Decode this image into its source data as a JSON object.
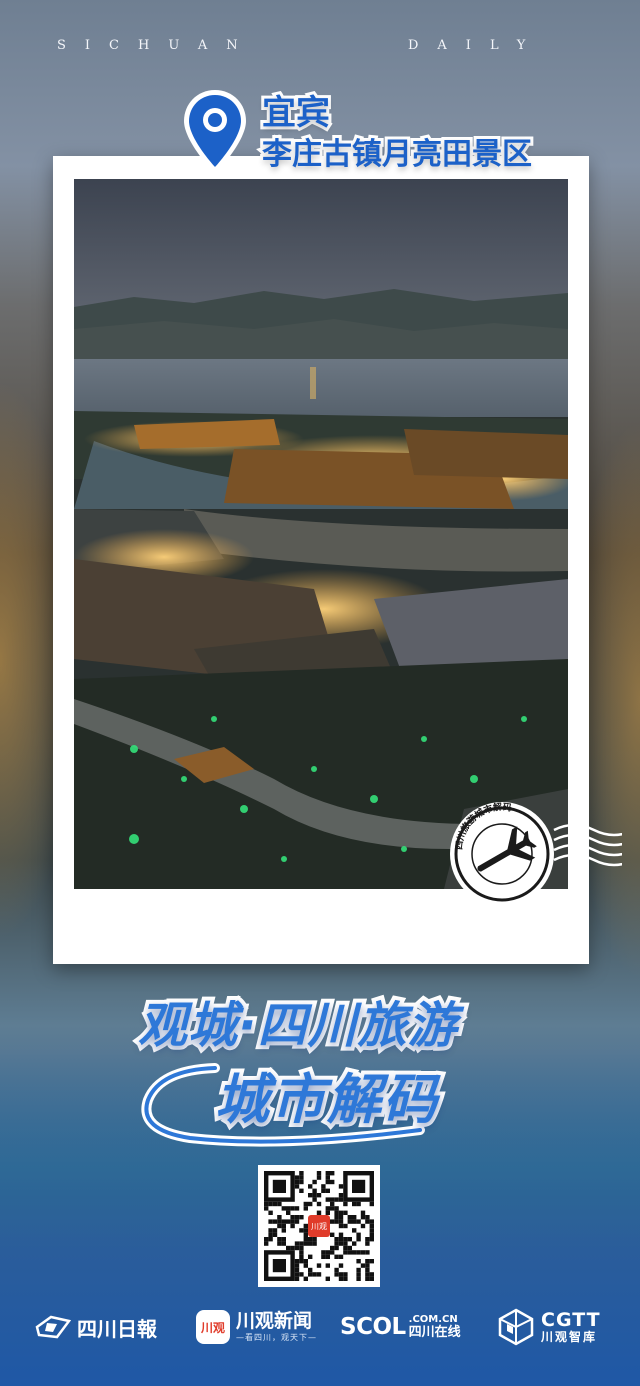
{
  "header": {
    "brand_left": "SICHUAN",
    "brand_right": "DAILY"
  },
  "location": {
    "city": "宜宾",
    "place": "李庄古镇月亮田景区"
  },
  "stamp": {
    "ring_text": "四川旅游城市解码"
  },
  "headline": {
    "line1": "观城·四川旅游",
    "line2": "城市解码"
  },
  "qr": {
    "center_label": "川观"
  },
  "footer": {
    "logo1": "四川日報",
    "logo2_app": "川观",
    "logo2_name": "川观新闻",
    "logo2_slogan": "—看四川，观天下—",
    "logo3_big": "SCOL",
    "logo3_domain": ".COM.CN",
    "logo3_cn": "四川在线",
    "logo4_big": "CGTT",
    "logo4_cn": "川观智库"
  },
  "colors": {
    "title_blue": "#2e78d8",
    "pin_blue": "#1c61c8",
    "frame_white": "#ffffff"
  }
}
